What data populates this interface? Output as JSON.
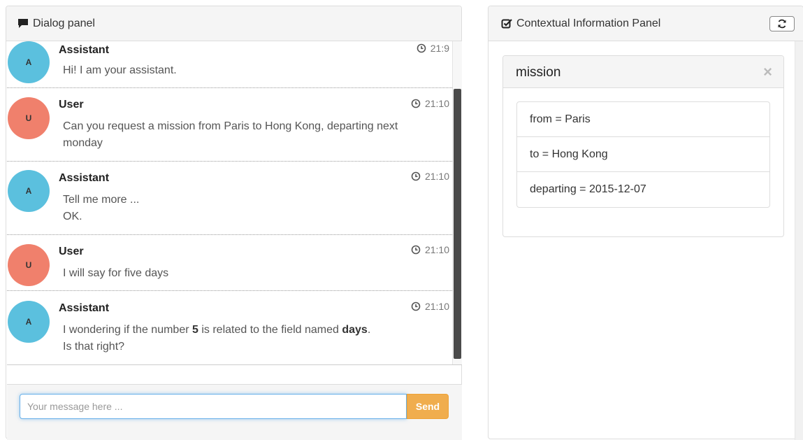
{
  "dialog_panel": {
    "title": "Dialog panel",
    "messages": [
      {
        "avatar": "A",
        "author": "Assistant",
        "time": "21:9",
        "lines": [
          "Hi! I am your assistant."
        ]
      },
      {
        "avatar": "U",
        "author": "User",
        "time": "21:10",
        "lines": [
          "Can you request a mission from Paris to Hong Kong, departing next monday"
        ]
      },
      {
        "avatar": "A",
        "author": "Assistant",
        "time": "21:10",
        "lines": [
          "Tell me more ...",
          "OK."
        ]
      },
      {
        "avatar": "U",
        "author": "User",
        "time": "21:10",
        "lines": [
          "I will say for five days"
        ]
      },
      {
        "avatar": "A",
        "author": "Assistant",
        "time": "21:10",
        "rich_line": {
          "pre": "I wondering if the number ",
          "b1": "5",
          "mid": " is related to the field named ",
          "b2": "days",
          "post": "."
        },
        "line2": "Is that right?"
      }
    ],
    "input_placeholder": "Your message here ...",
    "send_label": "Send"
  },
  "context_panel": {
    "title": "Contextual Information Panel",
    "card": {
      "title": "mission",
      "close_symbol": "×",
      "fields": [
        "from = Paris",
        "to = Hong Kong",
        "departing = 2015-12-07"
      ]
    }
  },
  "colors": {
    "assistant_avatar": "#5bc0de",
    "user_avatar": "#f0806c",
    "send_button": "#f0ad4e"
  },
  "icons": {
    "dialog_header": "comment-icon",
    "context_header": "check-square-icon",
    "refresh": "refresh-icon",
    "time": "clock-icon"
  }
}
